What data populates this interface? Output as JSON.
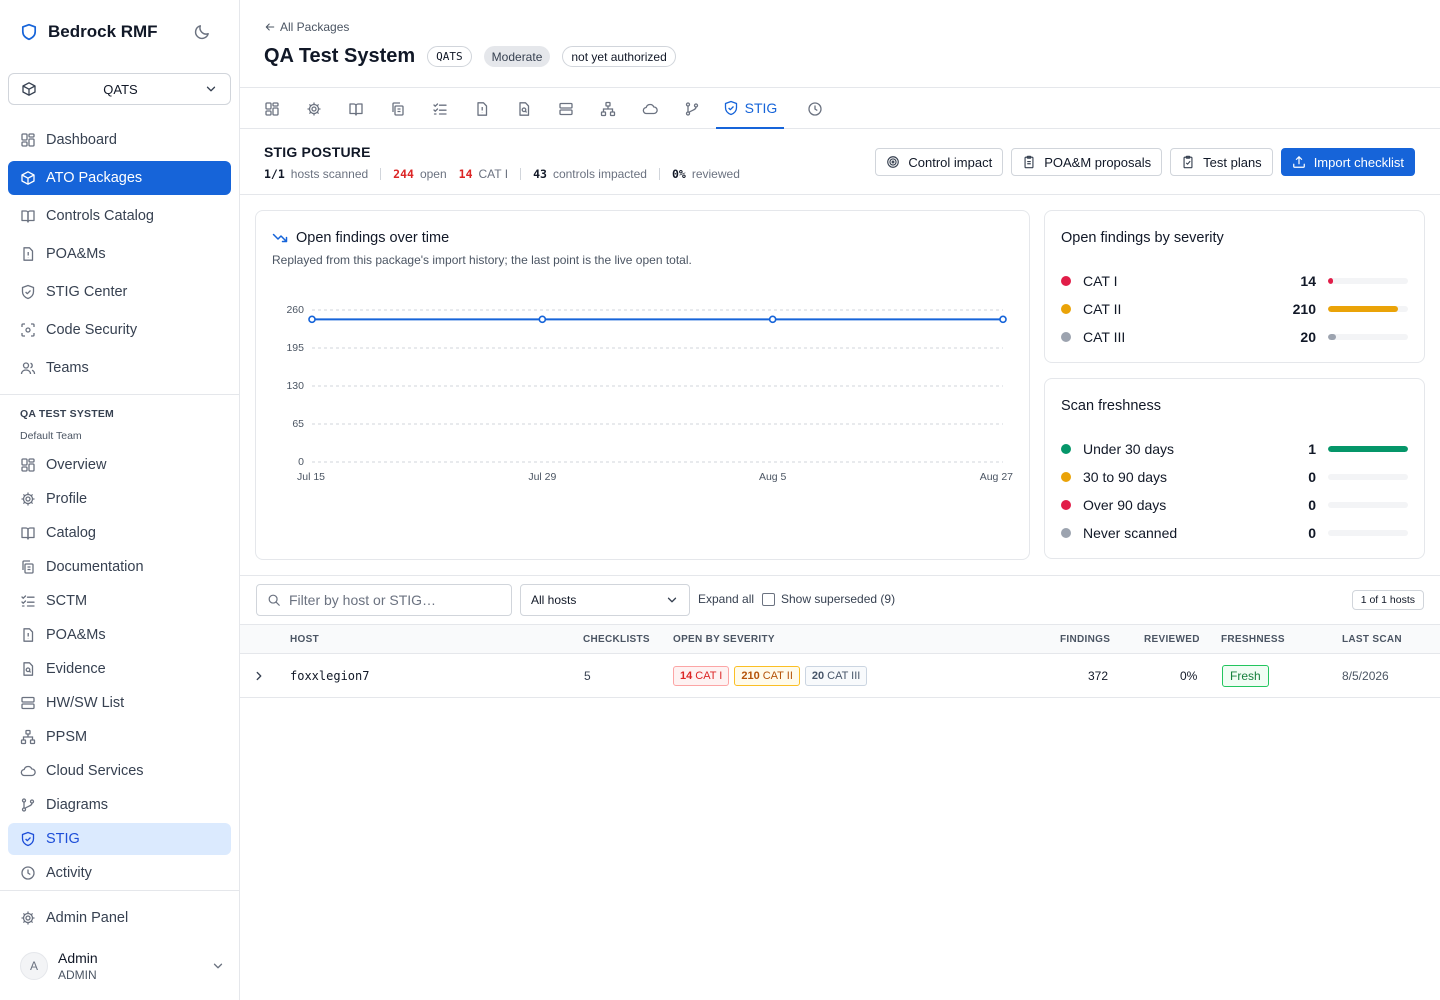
{
  "app": {
    "brand": "Bedrock RMF",
    "package_selector": "QATS"
  },
  "sidebar": {
    "main_nav": [
      {
        "label": "Dashboard",
        "icon": "dashboard-icon"
      },
      {
        "label": "ATO Packages",
        "icon": "package-icon",
        "active": true
      },
      {
        "label": "Controls Catalog",
        "icon": "book-icon"
      },
      {
        "label": "POA&Ms",
        "icon": "file-alert-icon"
      },
      {
        "label": "STIG Center",
        "icon": "shield-icon"
      },
      {
        "label": "Code Security",
        "icon": "scan-icon"
      },
      {
        "label": "Teams",
        "icon": "users-icon"
      }
    ],
    "section_title": "QA TEST SYSTEM",
    "section_subtitle": "Default Team",
    "package_nav": [
      {
        "label": "Overview",
        "icon": "dashboard-icon"
      },
      {
        "label": "Profile",
        "icon": "gear-icon"
      },
      {
        "label": "Catalog",
        "icon": "book-icon"
      },
      {
        "label": "Documentation",
        "icon": "docs-icon"
      },
      {
        "label": "SCTM",
        "icon": "checklist-icon"
      },
      {
        "label": "POA&Ms",
        "icon": "file-alert-icon"
      },
      {
        "label": "Evidence",
        "icon": "file-search-icon"
      },
      {
        "label": "HW/SW List",
        "icon": "server-icon"
      },
      {
        "label": "PPSM",
        "icon": "network-icon"
      },
      {
        "label": "Cloud Services",
        "icon": "cloud-icon"
      },
      {
        "label": "Diagrams",
        "icon": "branch-icon"
      },
      {
        "label": "STIG",
        "icon": "shield-icon",
        "active": true
      },
      {
        "label": "Activity",
        "icon": "clock-icon"
      }
    ],
    "admin_panel": "Admin Panel",
    "user": {
      "initial": "A",
      "name": "Admin",
      "role": "ADMIN"
    }
  },
  "header": {
    "back_link": "All Packages",
    "title": "QA Test System",
    "badges": [
      "QATS",
      "Moderate",
      "not yet authorized"
    ]
  },
  "tabs": [
    {
      "icon": "dashboard-icon"
    },
    {
      "icon": "gear-icon"
    },
    {
      "icon": "book-icon"
    },
    {
      "icon": "docs-icon"
    },
    {
      "icon": "checklist-icon"
    },
    {
      "icon": "file-alert-icon"
    },
    {
      "icon": "file-search-icon"
    },
    {
      "icon": "server-icon"
    },
    {
      "icon": "network-icon"
    },
    {
      "icon": "cloud-icon"
    },
    {
      "icon": "branch-icon"
    },
    {
      "icon": "shield-icon",
      "label": "STIG",
      "active": true
    },
    {
      "icon": "clock-icon"
    }
  ],
  "posture": {
    "heading": "STIG POSTURE",
    "hosts_scanned_value": "1/1",
    "hosts_scanned_label": "hosts scanned",
    "open_value": "244",
    "open_label": "open",
    "cat1_value": "14",
    "cat1_label": "CAT I",
    "controls_value": "43",
    "controls_label": "controls impacted",
    "reviewed_value": "0%",
    "reviewed_label": "reviewed"
  },
  "actions": {
    "control_impact": "Control impact",
    "poam_proposals": "POA&M proposals",
    "test_plans": "Test plans",
    "import_checklist": "Import checklist"
  },
  "trend_card": {
    "title": "Open findings over time",
    "description": "Replayed from this package's import history; the last point is the live open total."
  },
  "chart_data": {
    "type": "line",
    "x": [
      "Jul 15",
      "Jul 29",
      "Aug 5",
      "Aug 27"
    ],
    "series": [
      {
        "values": [
          244,
          244,
          244,
          244
        ],
        "color": "#1664d9"
      }
    ],
    "yticks": [
      0,
      65,
      130,
      195,
      260
    ],
    "ylim": [
      0,
      260
    ],
    "grid": true
  },
  "severity_card": {
    "title": "Open findings by severity",
    "rows": [
      {
        "label": "CAT I",
        "value": "14",
        "fraction": 0.0667,
        "color": "#e11d48"
      },
      {
        "label": "CAT II",
        "value": "210",
        "fraction": 0.875,
        "color": "#eaa308"
      },
      {
        "label": "CAT III",
        "value": "20",
        "fraction": 0.0952,
        "color": "#9ca3af"
      }
    ]
  },
  "freshness_card": {
    "title": "Scan freshness",
    "rows": [
      {
        "label": "Under 30 days",
        "value": "1",
        "fraction": 1.0,
        "color": "#059669"
      },
      {
        "label": "30 to 90 days",
        "value": "0",
        "fraction": 0,
        "color": "#eaa308"
      },
      {
        "label": "Over 90 days",
        "value": "0",
        "fraction": 0,
        "color": "#e11d48"
      },
      {
        "label": "Never scanned",
        "value": "0",
        "fraction": 0,
        "color": "#9ca3af"
      }
    ]
  },
  "filters": {
    "search_placeholder": "Filter by host or STIG…",
    "hosts_select": "All hosts",
    "expand_all": "Expand all",
    "show_superseded": "Show superseded (9)",
    "count": "1 of 1 hosts"
  },
  "table": {
    "headers": {
      "host": "HOST",
      "checklists": "CHECKLISTS",
      "open_by_severity": "OPEN BY SEVERITY",
      "findings": "FINDINGS",
      "reviewed": "REVIEWED",
      "freshness": "FRESHNESS",
      "last_scan": "LAST SCAN"
    },
    "rows": [
      {
        "host": "foxxlegion7",
        "checklists": "5",
        "cat1_count": "14",
        "cat1_label": "CAT I",
        "cat2_count": "210",
        "cat2_label": "CAT II",
        "cat3_count": "20",
        "cat3_label": "CAT III",
        "findings": "372",
        "reviewed": "0%",
        "freshness": "Fresh",
        "last_scan": "8/5/2026"
      }
    ]
  }
}
